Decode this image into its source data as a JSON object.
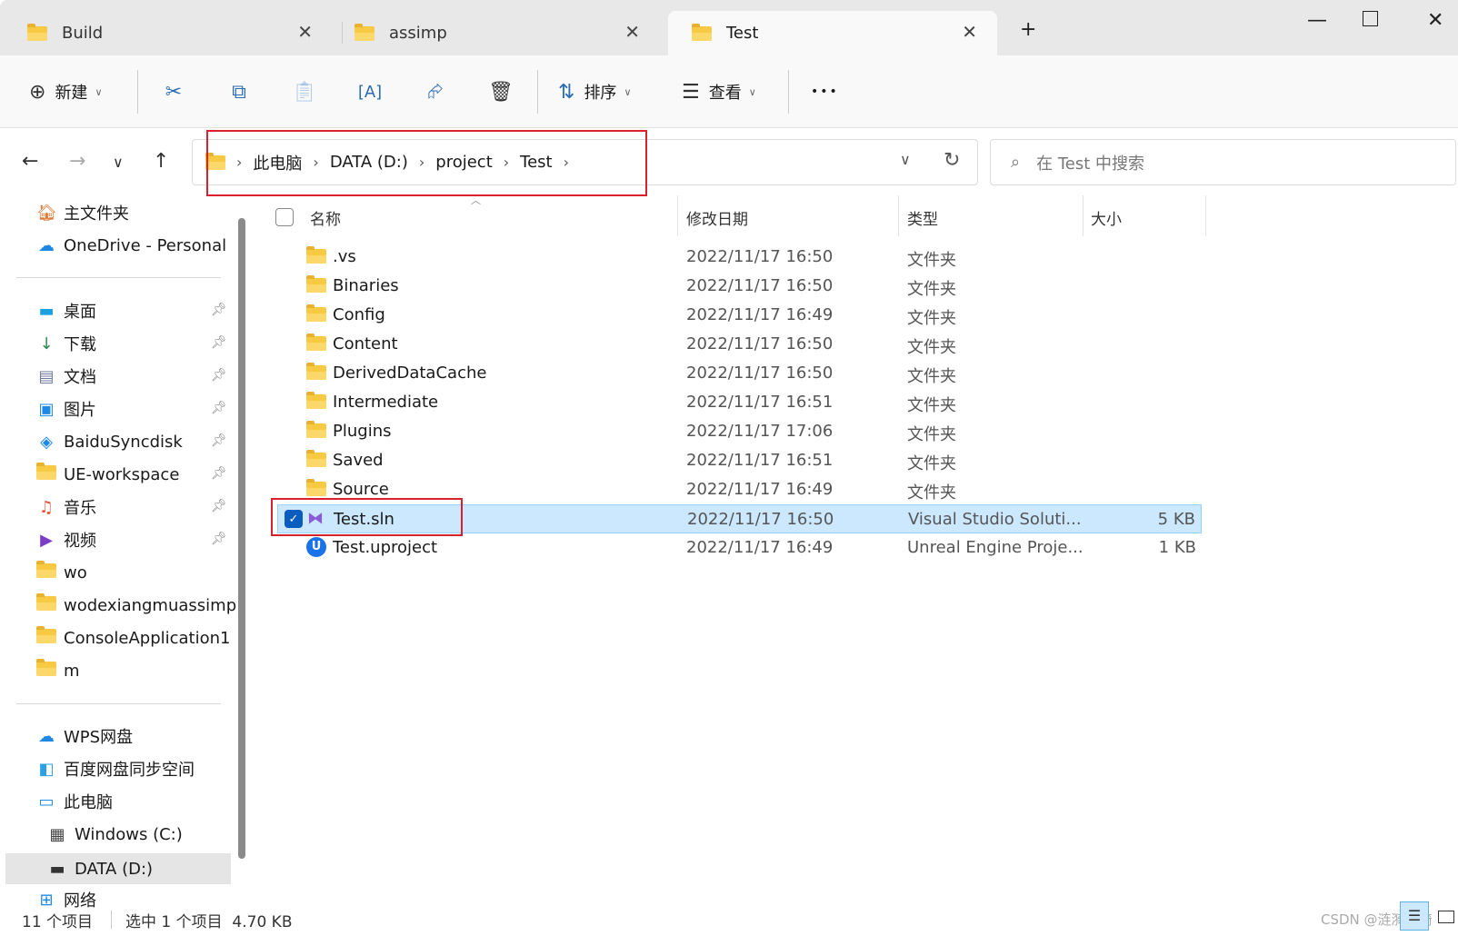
{
  "tabs": [
    {
      "label": "Build",
      "active": false
    },
    {
      "label": "assimp",
      "active": false
    },
    {
      "label": "Test",
      "active": true
    }
  ],
  "new_tab": "+",
  "toolbar": {
    "new_label": "新建",
    "sort_label": "排序",
    "view_label": "查看",
    "more": "•••",
    "icons": [
      "cut-icon",
      "copy-icon",
      "paste-icon",
      "rename-icon",
      "share-icon",
      "delete-icon"
    ]
  },
  "breadcrumb": [
    "此电脑",
    "DATA (D:)",
    "project",
    "Test"
  ],
  "search": {
    "placeholder": "在 Test 中搜索"
  },
  "sidebar": {
    "top": [
      {
        "label": "主文件夹",
        "icon": "home"
      },
      {
        "label": "OneDrive - Personal",
        "icon": "cloud"
      }
    ],
    "quick": [
      {
        "label": "桌面",
        "pinned": true
      },
      {
        "label": "下载",
        "pinned": true
      },
      {
        "label": "文档",
        "pinned": true
      },
      {
        "label": "图片",
        "pinned": true
      },
      {
        "label": "BaiduSyncdisk",
        "pinned": true
      },
      {
        "label": "UE-workspace",
        "pinned": true
      },
      {
        "label": "音乐",
        "pinned": true
      },
      {
        "label": "视频",
        "pinned": true
      },
      {
        "label": "wo"
      },
      {
        "label": "wodexiangmuassimp"
      },
      {
        "label": "ConsoleApplication1"
      },
      {
        "label": "m"
      }
    ],
    "bottom": [
      {
        "label": "WPS网盘"
      },
      {
        "label": "百度网盘同步空间"
      },
      {
        "label": "此电脑"
      },
      {
        "label": "Windows (C:)"
      },
      {
        "label": "DATA (D:)",
        "selected": true
      },
      {
        "label": "网络"
      }
    ]
  },
  "columns": {
    "name": "名称",
    "date": "修改日期",
    "type": "类型",
    "size": "大小"
  },
  "files": [
    {
      "name": ".vs",
      "date": "2022/11/17 16:50",
      "type": "文件夹",
      "size": "",
      "kind": "folder"
    },
    {
      "name": "Binaries",
      "date": "2022/11/17 16:50",
      "type": "文件夹",
      "size": "",
      "kind": "folder"
    },
    {
      "name": "Config",
      "date": "2022/11/17 16:49",
      "type": "文件夹",
      "size": "",
      "kind": "folder"
    },
    {
      "name": "Content",
      "date": "2022/11/17 16:50",
      "type": "文件夹",
      "size": "",
      "kind": "folder"
    },
    {
      "name": "DerivedDataCache",
      "date": "2022/11/17 16:50",
      "type": "文件夹",
      "size": "",
      "kind": "folder"
    },
    {
      "name": "Intermediate",
      "date": "2022/11/17 16:51",
      "type": "文件夹",
      "size": "",
      "kind": "folder"
    },
    {
      "name": "Plugins",
      "date": "2022/11/17 17:06",
      "type": "文件夹",
      "size": "",
      "kind": "folder"
    },
    {
      "name": "Saved",
      "date": "2022/11/17 16:51",
      "type": "文件夹",
      "size": "",
      "kind": "folder"
    },
    {
      "name": "Source",
      "date": "2022/11/17 16:49",
      "type": "文件夹",
      "size": "",
      "kind": "folder"
    },
    {
      "name": "Test.sln",
      "date": "2022/11/17 16:50",
      "type": "Visual Studio Soluti...",
      "size": "5 KB",
      "kind": "sln",
      "selected": true
    },
    {
      "name": "Test.uproject",
      "date": "2022/11/17 16:49",
      "type": "Unreal Engine Proje...",
      "size": "1 KB",
      "kind": "uproject"
    }
  ],
  "status": {
    "count": "11 个项目",
    "selection": "选中 1 个项目  4.70 KB"
  },
  "watermark": "CSDN @涟漪涟漪"
}
